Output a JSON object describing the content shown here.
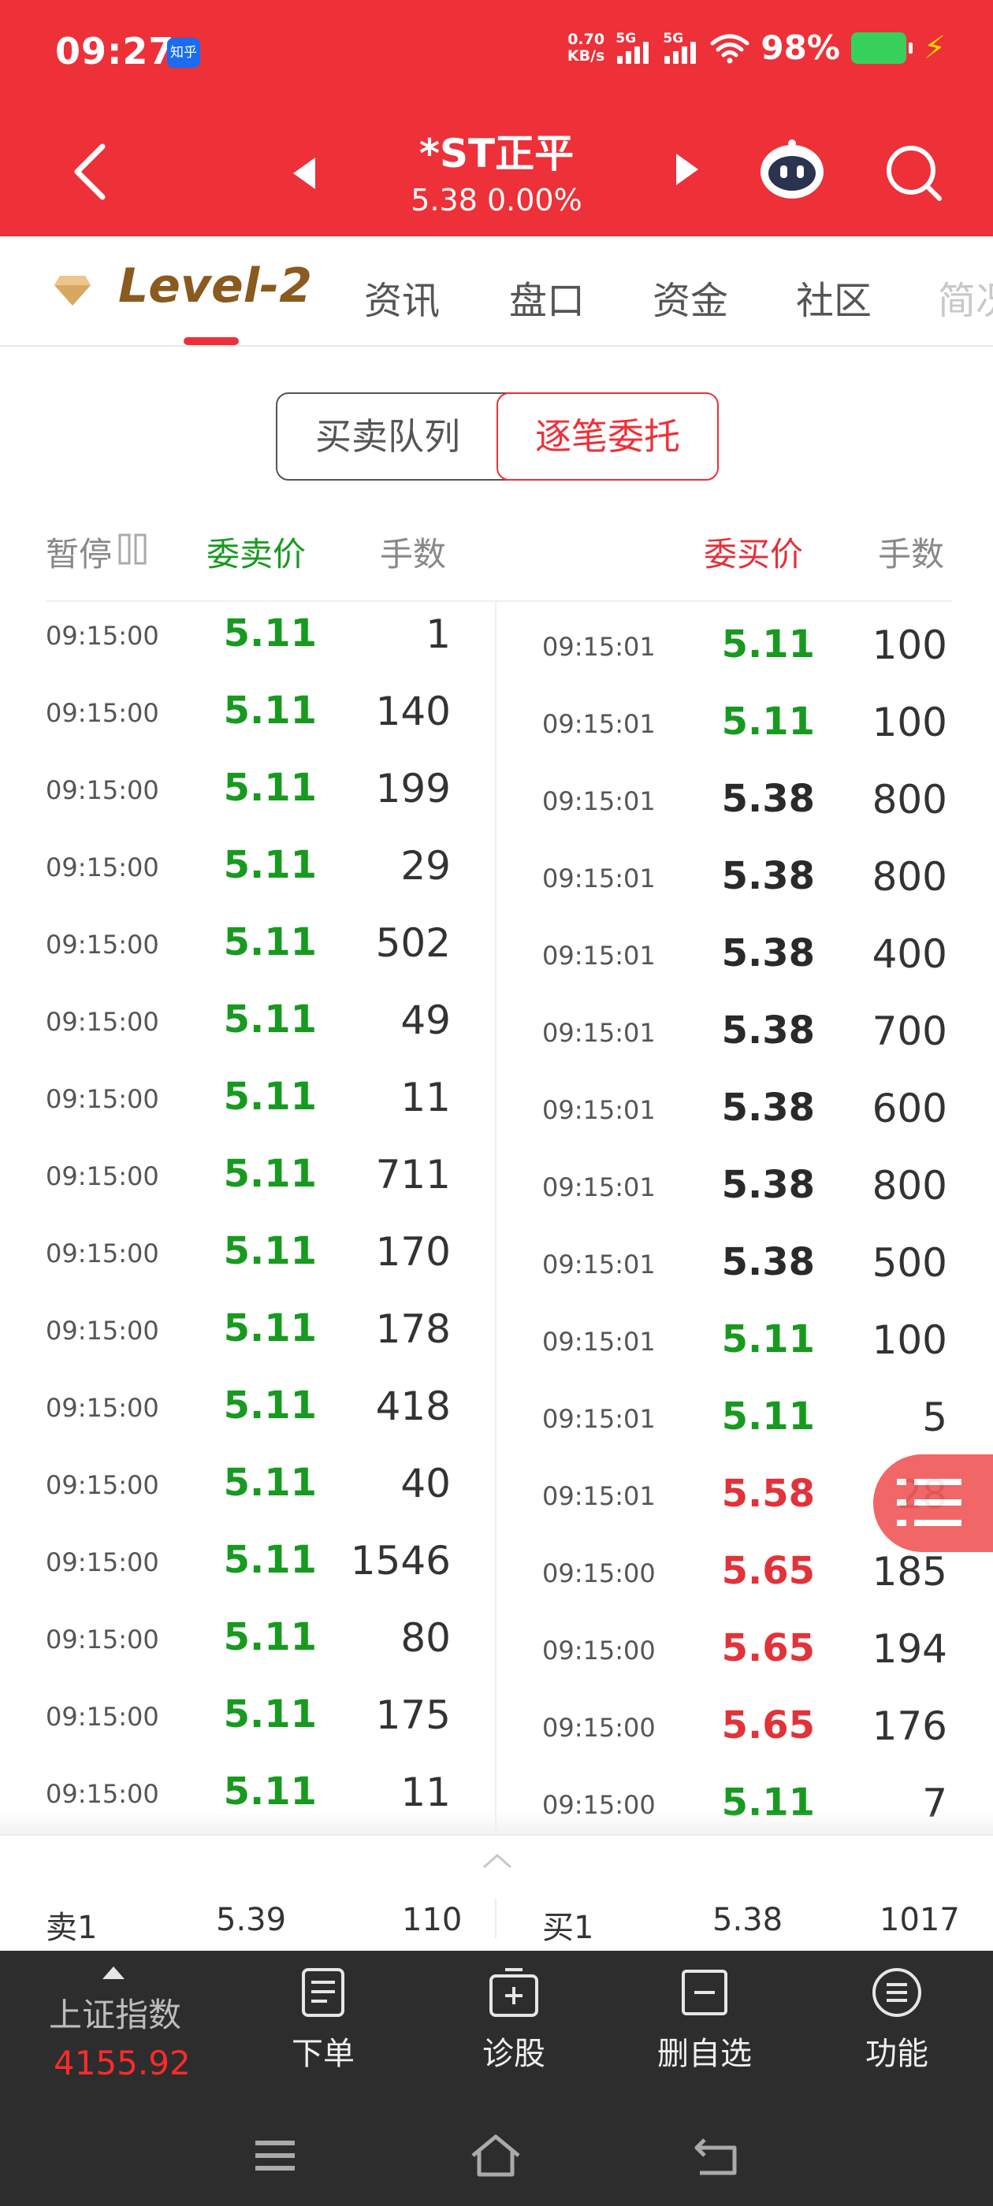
{
  "status_bar": {
    "time": "09:27",
    "app_badge": "知乎",
    "net_speed_value": "0.70",
    "net_speed_unit": "KB/s",
    "signal1_label": "5G",
    "signal2_label": "5G",
    "battery": "98%"
  },
  "header": {
    "stock_name": "*ST正平",
    "stock_price": "5.38 0.00%"
  },
  "tabs": {
    "level2": "Level-2",
    "items": [
      "资讯",
      "盘口",
      "资金",
      "社区",
      "简况"
    ]
  },
  "segment": {
    "left": "买卖队列",
    "right": "逐笔委托"
  },
  "columns": {
    "pause": "暂停",
    "sell_price": "委卖价",
    "sell_qty": "手数",
    "buy_price": "委买价",
    "buy_qty": "手数"
  },
  "sell_rows": [
    {
      "time": "09:15:00",
      "price": "5.11",
      "qty": "1"
    },
    {
      "time": "09:15:00",
      "price": "5.11",
      "qty": "140"
    },
    {
      "time": "09:15:00",
      "price": "5.11",
      "qty": "199"
    },
    {
      "time": "09:15:00",
      "price": "5.11",
      "qty": "29"
    },
    {
      "time": "09:15:00",
      "price": "5.11",
      "qty": "502"
    },
    {
      "time": "09:15:00",
      "price": "5.11",
      "qty": "49"
    },
    {
      "time": "09:15:00",
      "price": "5.11",
      "qty": "11"
    },
    {
      "time": "09:15:00",
      "price": "5.11",
      "qty": "711"
    },
    {
      "time": "09:15:00",
      "price": "5.11",
      "qty": "170"
    },
    {
      "time": "09:15:00",
      "price": "5.11",
      "qty": "178"
    },
    {
      "time": "09:15:00",
      "price": "5.11",
      "qty": "418"
    },
    {
      "time": "09:15:00",
      "price": "5.11",
      "qty": "40"
    },
    {
      "time": "09:15:00",
      "price": "5.11",
      "qty": "1546"
    },
    {
      "time": "09:15:00",
      "price": "5.11",
      "qty": "80"
    },
    {
      "time": "09:15:00",
      "price": "5.11",
      "qty": "175"
    },
    {
      "time": "09:15:00",
      "price": "5.11",
      "qty": "11"
    }
  ],
  "buy_rows": [
    {
      "time": "09:15:01",
      "price": "5.11",
      "qty": "100",
      "color": "green"
    },
    {
      "time": "09:15:01",
      "price": "5.11",
      "qty": "100",
      "color": "green"
    },
    {
      "time": "09:15:01",
      "price": "5.38",
      "qty": "800",
      "color": "black"
    },
    {
      "time": "09:15:01",
      "price": "5.38",
      "qty": "800",
      "color": "black"
    },
    {
      "time": "09:15:01",
      "price": "5.38",
      "qty": "400",
      "color": "black"
    },
    {
      "time": "09:15:01",
      "price": "5.38",
      "qty": "700",
      "color": "black"
    },
    {
      "time": "09:15:01",
      "price": "5.38",
      "qty": "600",
      "color": "black"
    },
    {
      "time": "09:15:01",
      "price": "5.38",
      "qty": "800",
      "color": "black"
    },
    {
      "time": "09:15:01",
      "price": "5.38",
      "qty": "500",
      "color": "black"
    },
    {
      "time": "09:15:01",
      "price": "5.11",
      "qty": "100",
      "color": "green"
    },
    {
      "time": "09:15:01",
      "price": "5.11",
      "qty": "5",
      "color": "green"
    },
    {
      "time": "09:15:01",
      "price": "5.58",
      "qty": "28",
      "color": "red"
    },
    {
      "time": "09:15:00",
      "price": "5.65",
      "qty": "185",
      "color": "red"
    },
    {
      "time": "09:15:00",
      "price": "5.65",
      "qty": "194",
      "color": "red"
    },
    {
      "time": "09:15:00",
      "price": "5.65",
      "qty": "176",
      "color": "red"
    },
    {
      "time": "09:15:00",
      "price": "5.11",
      "qty": "7",
      "color": "green"
    }
  ],
  "summary": {
    "sell_label": "卖1",
    "sell_price": "5.39",
    "sell_qty": "110",
    "buy_label": "买1",
    "buy_price": "5.38",
    "buy_qty": "1017"
  },
  "toolbar": {
    "index_name": "上证指数",
    "index_value": "4155.92",
    "order": "下单",
    "diagnose": "诊股",
    "remove_watch": "删自选",
    "functions": "功能"
  },
  "colors": {
    "brand_red": "#ee3038",
    "price_green": "#179a1f",
    "price_red": "#e2323a",
    "level2_gold": "#8a5a1e",
    "toolbar_bg": "#2d2d2d"
  }
}
